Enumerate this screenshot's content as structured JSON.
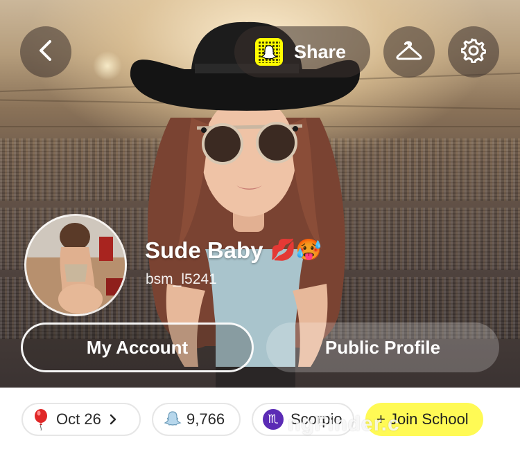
{
  "header": {
    "share_label": "Share"
  },
  "profile": {
    "display_name": "Sude Baby",
    "name_emojis": "💋🥵",
    "username": "bsm_l5241"
  },
  "actions": {
    "my_account_label": "My Account",
    "public_profile_label": "Public Profile"
  },
  "chips": {
    "birthday": "Oct 26",
    "snap_score": "9,766",
    "zodiac": "Scorpio",
    "zodiac_symbol": "♏",
    "join_school": "+ Join School"
  },
  "watermark": "ngFinder.c",
  "colors": {
    "snapchat_yellow": "#fffc00",
    "join_chip_yellow": "#fffa55",
    "zodiac_purple": "#5b2bb5"
  }
}
